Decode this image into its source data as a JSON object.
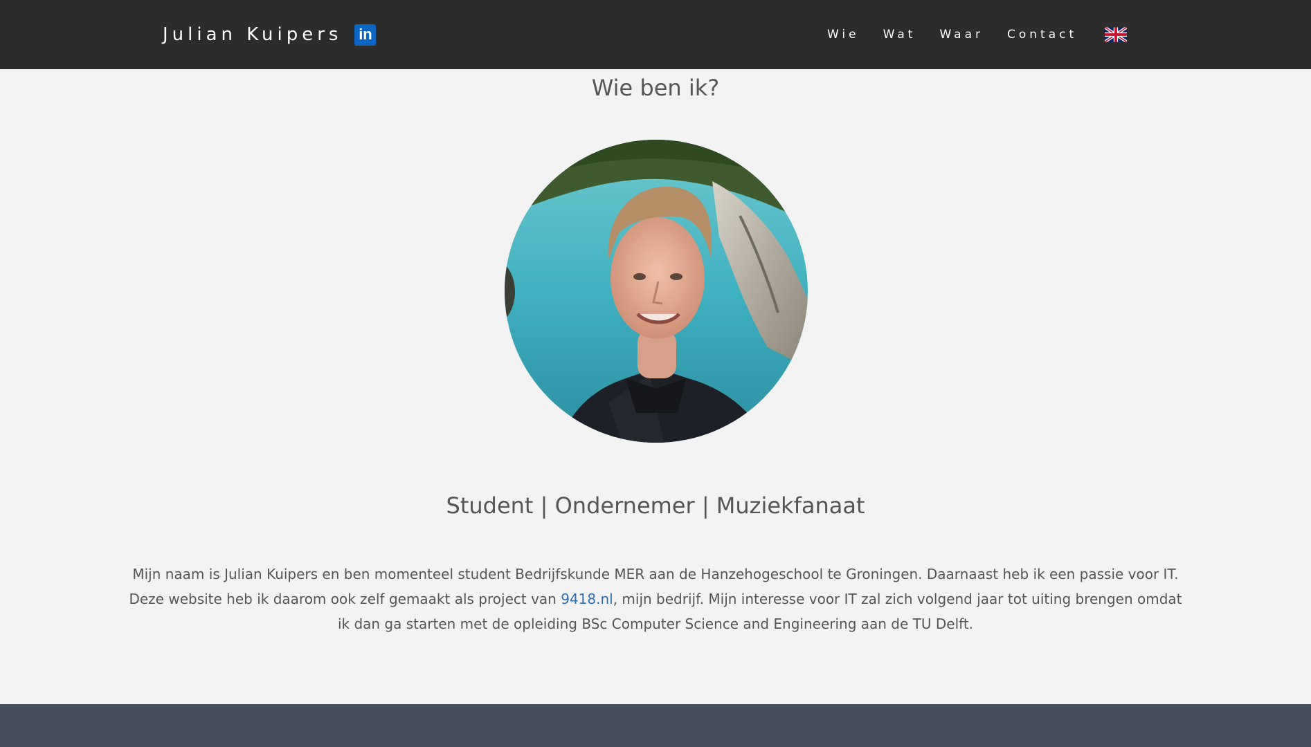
{
  "header": {
    "brand_name": "Julian Kuipers",
    "linkedin_label": "in",
    "nav": {
      "wie": "Wie",
      "wat": "Wat",
      "waar": "Waar",
      "contact": "Contact"
    },
    "language_icon": "uk-flag-icon"
  },
  "about": {
    "title": "Wie ben ik?",
    "tagline": "Student | Ondernemer | Muziekfanaat",
    "bio_part1": "Mijn naam is Julian Kuipers en ben momenteel student Bedrijfskunde MER aan de Hanzehogeschool te Groningen. Daarnaast heb ik een passie voor IT. Deze website heb ik daarom ook zelf gemaakt als project van ",
    "bio_link": "9418.nl",
    "bio_part2": ", mijn bedrijf. Mijn interesse voor IT zal zich volgend jaar tot uiting brengen omdat ik dan ga starten met de opleiding BSc Computer Science and Engineering aan de TU Delft."
  },
  "colors": {
    "navbar": "#2c2c2c",
    "page_background": "#f3f3f3",
    "link": "#2f6fb0",
    "footer": "#474f5e",
    "linkedin": "#0a66c2"
  }
}
